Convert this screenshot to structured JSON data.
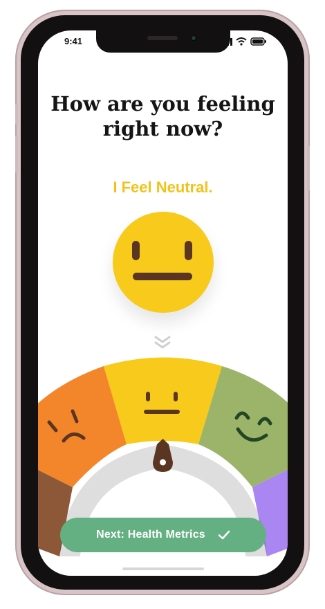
{
  "status_bar": {
    "time": "9:41"
  },
  "question": {
    "line1": "How are you feeling",
    "line2": "right now?"
  },
  "mood": {
    "label": "I Feel Neutral.",
    "selected": "neutral",
    "options": [
      "sad",
      "neutral",
      "happy"
    ]
  },
  "footer": {
    "next_label": "Next: Health Metrics"
  },
  "colors": {
    "sad": "#f3862a",
    "neutral": "#f7ca1b",
    "happy": "#9cb46a",
    "brown": "#8d5838",
    "purple": "#a986f1",
    "button": "#64b083",
    "face_feature": "#5a3522"
  },
  "icons": [
    "wifi-icon",
    "battery-icon",
    "signal-icon",
    "chevron-down-icon",
    "check-icon"
  ]
}
